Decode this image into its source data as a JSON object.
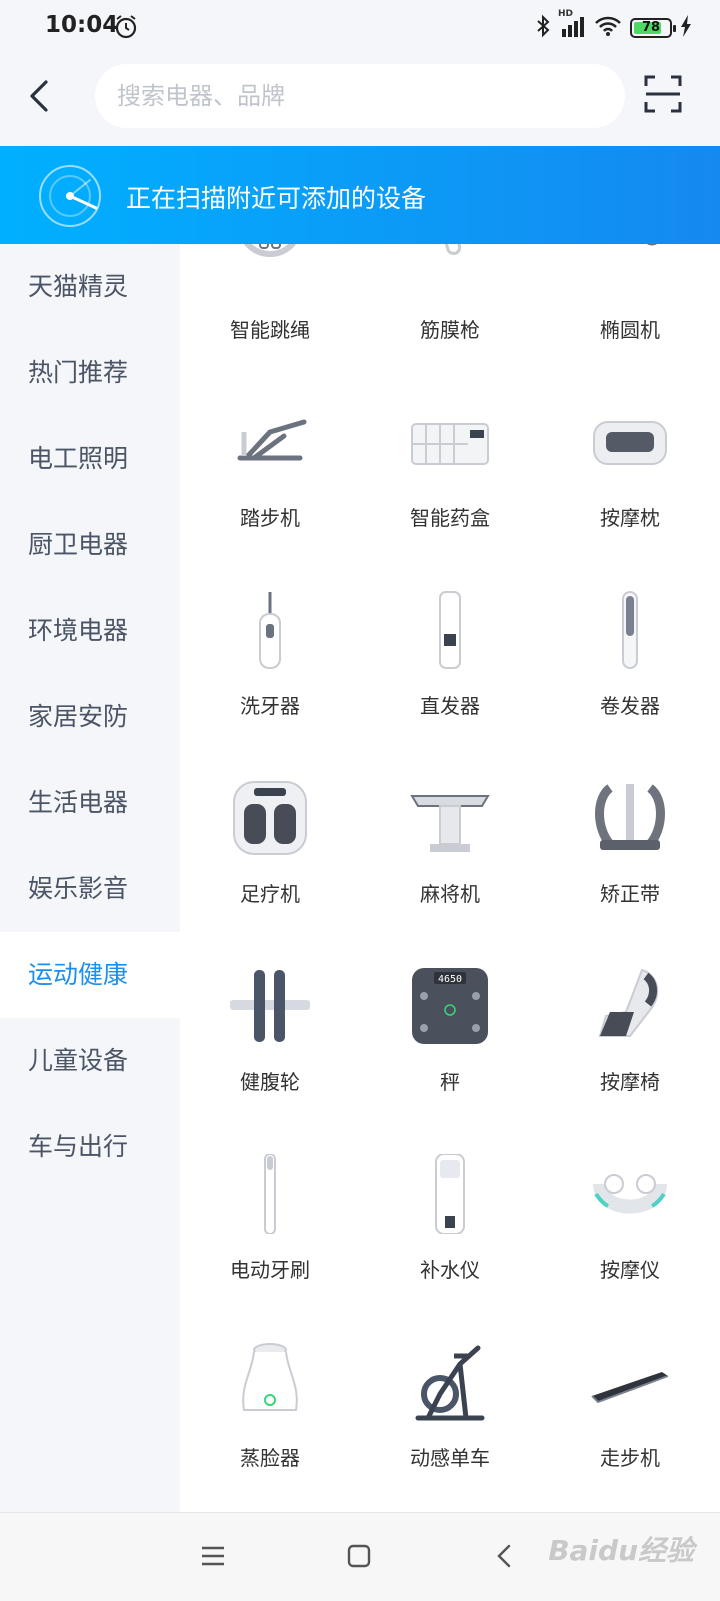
{
  "status": {
    "time": "10:04",
    "battery": "78",
    "battery_level": 0.78,
    "network": "HD"
  },
  "search": {
    "placeholder": "搜索电器、品牌"
  },
  "banner": {
    "text": "正在扫描附近可添加的设备"
  },
  "sidebar": {
    "items": [
      {
        "label": "天猫精灵",
        "active": false
      },
      {
        "label": "热门推荐",
        "active": false
      },
      {
        "label": "电工照明",
        "active": false
      },
      {
        "label": "厨卫电器",
        "active": false
      },
      {
        "label": "环境电器",
        "active": false
      },
      {
        "label": "家居安防",
        "active": false
      },
      {
        "label": "生活电器",
        "active": false
      },
      {
        "label": "娱乐影音",
        "active": false
      },
      {
        "label": "运动健康",
        "active": true
      },
      {
        "label": "儿童设备",
        "active": false
      },
      {
        "label": "车与出行",
        "active": false
      }
    ]
  },
  "devices": [
    {
      "label": "智能跳绳",
      "icon": "jump-rope-icon"
    },
    {
      "label": "筋膜枪",
      "icon": "massage-gun-icon"
    },
    {
      "label": "椭圆机",
      "icon": "elliptical-machine-icon"
    },
    {
      "label": "踏步机",
      "icon": "stepper-machine-icon"
    },
    {
      "label": "智能药盒",
      "icon": "pill-box-icon"
    },
    {
      "label": "按摩枕",
      "icon": "massage-pillow-icon"
    },
    {
      "label": "洗牙器",
      "icon": "water-flosser-icon"
    },
    {
      "label": "直发器",
      "icon": "hair-straightener-icon"
    },
    {
      "label": "卷发器",
      "icon": "curling-iron-icon"
    },
    {
      "label": "足疗机",
      "icon": "foot-massager-icon"
    },
    {
      "label": "麻将机",
      "icon": "mahjong-table-icon"
    },
    {
      "label": "矫正带",
      "icon": "posture-corrector-icon"
    },
    {
      "label": "健腹轮",
      "icon": "ab-wheel-icon"
    },
    {
      "label": "秤",
      "icon": "scale-icon",
      "display": "4650"
    },
    {
      "label": "按摩椅",
      "icon": "massage-chair-icon"
    },
    {
      "label": "电动牙刷",
      "icon": "electric-toothbrush-icon"
    },
    {
      "label": "补水仪",
      "icon": "face-mister-icon"
    },
    {
      "label": "按摩仪",
      "icon": "neck-massager-icon"
    },
    {
      "label": "蒸脸器",
      "icon": "facial-steamer-icon"
    },
    {
      "label": "动感单车",
      "icon": "spin-bike-icon"
    },
    {
      "label": "走步机",
      "icon": "walking-pad-icon"
    }
  ],
  "watermark": "Baidu经验",
  "colors": {
    "accent": "#1a8ff0",
    "banner_start": "#00b0ff",
    "banner_end": "#1589f0"
  }
}
